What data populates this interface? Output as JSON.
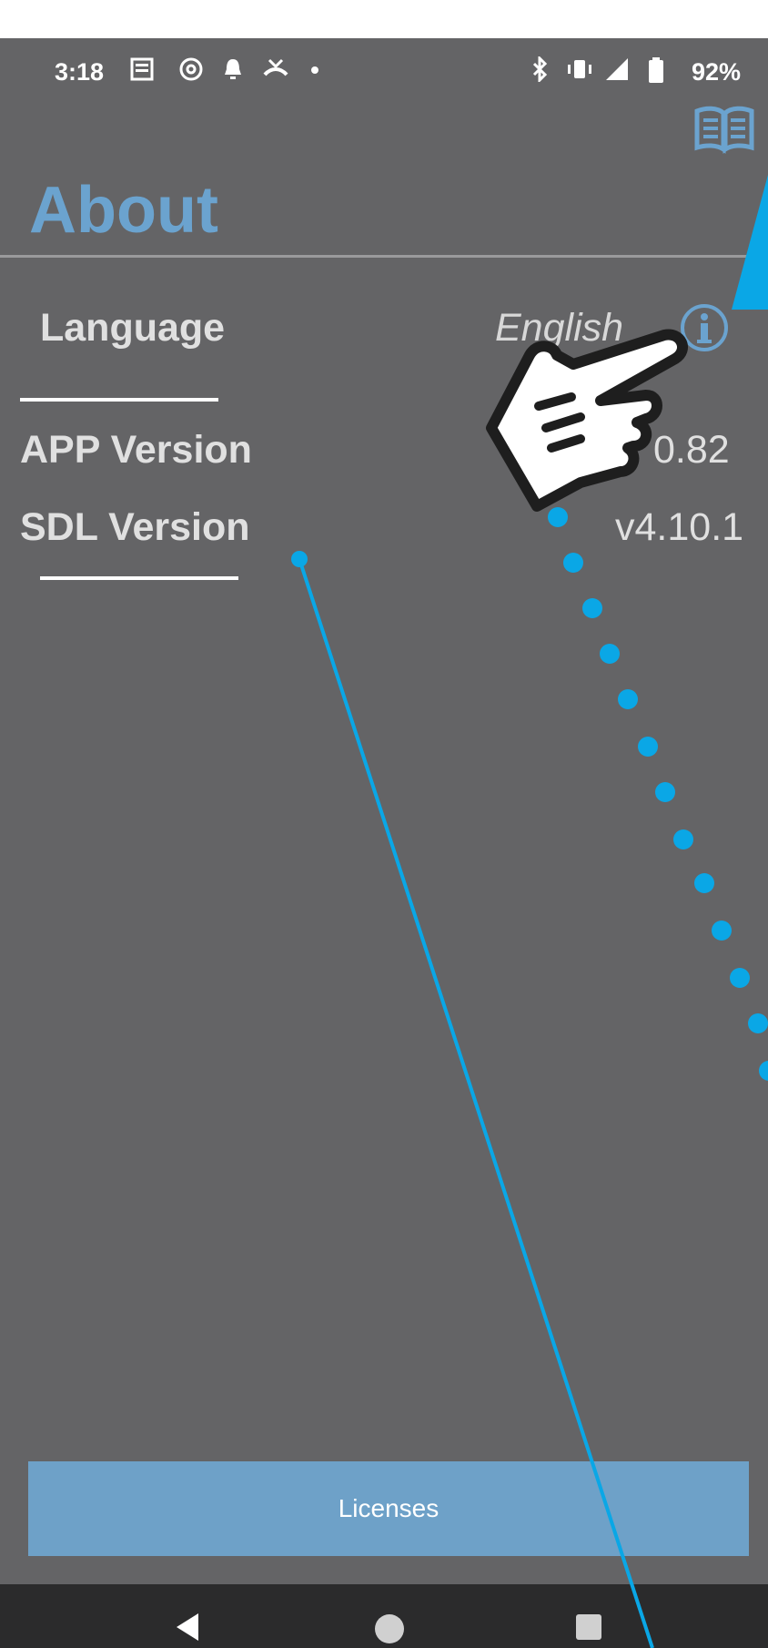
{
  "status_bar": {
    "time": "3:18",
    "left_icons": [
      "news-icon",
      "threads-icon",
      "bell-icon",
      "missed-call-icon",
      "dot-icon"
    ],
    "right_icons": [
      "bluetooth-icon",
      "vibrate-icon",
      "signal-icon",
      "battery-icon"
    ],
    "battery": "92%"
  },
  "header": {
    "title": "About",
    "manual_icon": "book-icon"
  },
  "rows": {
    "language": {
      "label": "Language",
      "value": "English",
      "info_icon": "info-icon"
    },
    "app_version": {
      "label": "APP Version",
      "value": "0.82"
    },
    "sdl_version": {
      "label": "SDL Version",
      "value": "v4.10.1"
    }
  },
  "footer": {
    "licenses_label": "Licenses"
  },
  "navigation": {
    "back": "back-icon",
    "home": "home-icon",
    "recents": "recents-icon"
  },
  "colors": {
    "background": "#646466",
    "accent": "#6ba3cf",
    "annotation": "#0aa7e6",
    "licenses_button": "#6ea1c8",
    "navbar": "#2b2b2c"
  }
}
